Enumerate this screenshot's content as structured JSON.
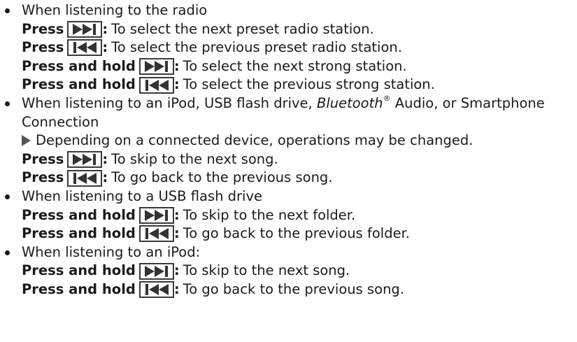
{
  "sections": [
    {
      "heading": "When listening to the radio",
      "items": [
        {
          "prefix": "Press",
          "icon": "next-track-icon",
          "text": "To select the next preset radio station."
        },
        {
          "prefix": "Press",
          "icon": "previous-track-icon",
          "text": "To select the previous preset radio station."
        },
        {
          "prefix": "Press and hold",
          "icon": "next-track-icon",
          "text": "To select the next strong station."
        },
        {
          "prefix": "Press and hold",
          "icon": "previous-track-icon",
          "text": "To select the previous strong station."
        }
      ]
    },
    {
      "heading_part1": "When listening to an iPod, USB flash drive, ",
      "heading_italic": "Bluetooth",
      "heading_sup": "®",
      "heading_part2": " Audio, or Smartphone",
      "heading_line2": "Connection",
      "note": "Depending on a connected device, operations may be changed.",
      "items": [
        {
          "prefix": "Press",
          "icon": "next-track-icon",
          "text": "To skip to the next song."
        },
        {
          "prefix": "Press",
          "icon": "previous-track-icon",
          "text": "To go back to the previous song."
        }
      ]
    },
    {
      "heading": "When listening to a USB flash drive",
      "items": [
        {
          "prefix": "Press and hold",
          "icon": "next-track-icon",
          "text": "To skip to the next folder."
        },
        {
          "prefix": "Press and hold",
          "icon": "previous-track-icon",
          "text": "To go back to the previous folder."
        }
      ]
    },
    {
      "heading": "When listening to an iPod:",
      "items": [
        {
          "prefix": "Press and hold",
          "icon": "next-track-icon",
          "text": "To skip to the next song."
        },
        {
          "prefix": "Press and hold",
          "icon": "previous-track-icon",
          "text": "To go back to the previous song."
        }
      ]
    }
  ],
  "colon": ":",
  "colors": {
    "text": "#1a1a1a",
    "icon_border": "#3a3a3a",
    "icon_fill": "#333333",
    "note_arrow": "#555555"
  }
}
